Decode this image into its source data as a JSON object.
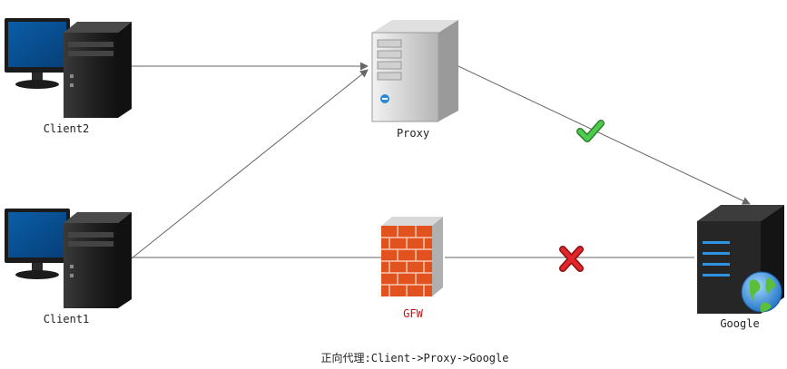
{
  "nodes": {
    "client2": {
      "label": "Client2"
    },
    "client1": {
      "label": "Client1"
    },
    "proxy": {
      "label": "Proxy"
    },
    "gfw": {
      "label": "GFW"
    },
    "google": {
      "label": "Google"
    }
  },
  "caption": "正向代理:Client->Proxy->Google",
  "colors": {
    "link": "#666666",
    "check": "#3cb44a",
    "cross": "#d8242a",
    "gfw_label": "#cc1111"
  }
}
